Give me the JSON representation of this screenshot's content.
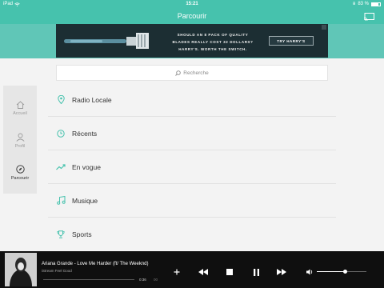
{
  "status": {
    "carrier": "iPad",
    "time": "15:21",
    "battery_text": "83 %",
    "battery_level": 0.83
  },
  "nav": {
    "title": "Parcourir"
  },
  "ad": {
    "line1": "SHOULD AN 8 PACK OF QUALITY",
    "line2": "BLADES REALLY COST 32 DOLLARS?",
    "line3": "HARRY'S. WORTH THE SWITCH.",
    "cta": "TRY HARRY'S"
  },
  "search": {
    "placeholder": "Recherche"
  },
  "sidebar": {
    "items": [
      {
        "label": "Accueil",
        "icon": "home-icon"
      },
      {
        "label": "Profil",
        "icon": "profile-icon"
      },
      {
        "label": "Parcourir",
        "icon": "compass-icon",
        "active": true
      }
    ]
  },
  "categories": [
    {
      "label": "Radio Locale",
      "icon": "location-pin-icon"
    },
    {
      "label": "Récents",
      "icon": "clock-icon"
    },
    {
      "label": "En vogue",
      "icon": "trending-icon"
    },
    {
      "label": "Musique",
      "icon": "music-note-icon"
    },
    {
      "label": "Sports",
      "icon": "trophy-icon"
    }
  ],
  "player": {
    "title": "Ariana Grande - Love Me Harder (ft/ The Weeknd)",
    "station": "iStream Feel Good",
    "elapsed": "0:36",
    "duration": "00",
    "progress": 0.0,
    "volume": 0.58
  },
  "colors": {
    "accent": "#46c2ad",
    "player_bg": "#0f0f0f"
  }
}
